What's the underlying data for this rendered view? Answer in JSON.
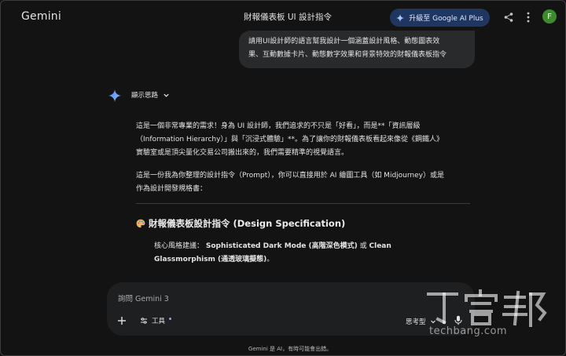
{
  "header": {
    "brand": "Gemini",
    "chat_title": "財報儀表板 UI 設計指令",
    "upgrade_label": "升級至 Google AI Plus",
    "avatar_initial": "F"
  },
  "conversation": {
    "user_prompt_line1": "請用UI設計師的語言幫我設計一個涵蓋設計風格、動態圖表效",
    "user_prompt_line2": "果、互動數據卡片、動態數字效果和背景特效的財報儀表板指令",
    "thinking_label": "顯示思路",
    "response_p1_line1": "這是一個非常專業的需求！身為 UI 設計師，我們追求的不只是「好看」，而是**「資訊層級",
    "response_p1_line2": "（Information Hierarchy）」與「沉浸式體驗」**。為了讓你的財報儀表板看起來像從《鋼鐵人》",
    "response_p1_line3": "實驗室或是頂尖量化交易公司搬出來的，我們需要精準的視覺語言。",
    "response_p2_line1": "這是一份我為你整理的設計指令（Prompt），你可以直接用於 AI 繪圖工具（如 Midjourney）或是",
    "response_p2_line2": "作為設計開發規格書：",
    "section_title": "財報儀表板設計指令 (Design Specification)",
    "bullet_prefix": "核心風格建議：",
    "bullet_bold1": "Sophisticated Dark Mode (高階深色模式)",
    "bullet_connector": " 或 ",
    "bullet_bold2": "Clean",
    "bullet_bold3": "Glassmorphism (通透玻璃擬態)",
    "bullet_end": "。"
  },
  "input": {
    "placeholder": "詢問 Gemini 3",
    "tools_label": "工具",
    "mode_label": "思考型"
  },
  "footer": {
    "disclaimer": "Gemini 是 AI，有時可能會出錯。"
  },
  "watermark": {
    "url": "techbang.com"
  },
  "colors": {
    "background": "#131314",
    "bubble": "#282a2c",
    "upgrade_button": "#1f3760",
    "accent": "#4b8df8",
    "avatar": "#3d8b2e"
  }
}
